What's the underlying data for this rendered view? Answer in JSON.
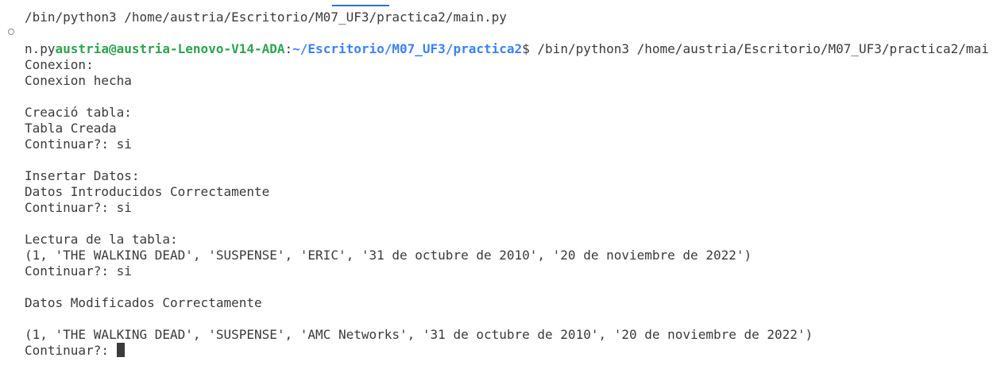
{
  "terminal": {
    "lines": [
      "/bin/python3 /home/austria/Escritorio/M07_UF3/practica2/main.py",
      "",
      "n.py",
      "Conexion:",
      "Conexion hecha",
      "",
      "Creació tabla:",
      "Tabla Creada",
      "Continuar?: si",
      "",
      "Insertar Datos:",
      "Datos Introducidos Correctamente",
      "Continuar?: si",
      "",
      "Lectura de la tabla:",
      "(1, 'THE WALKING DEAD', 'SUSPENSE', 'ERIC', '31 de octubre de 2010', '20 de noviembre de 2022')",
      "Continuar?: si",
      "",
      "Datos Modificados Correctamente",
      "",
      "(1, 'THE WALKING DEAD', 'SUSPENSE', 'AMC Networks', '31 de octubre de 2010', '20 de noviembre de 2022')",
      "Continuar?: "
    ],
    "prompt": {
      "user_host": "austria@austria-Lenovo-V14-ADA",
      "separator": ":",
      "path": "~/Escritorio/M07_UF3/practica2",
      "symbol": "$",
      "command": " /bin/python3 /home/austria/Escritorio/M07_UF3/practica2/mai"
    },
    "colors": {
      "user_host": "#2da44e",
      "path": "#3b82f6",
      "text": "#3b3b3b",
      "tab_indicator": "#2f6fd6"
    }
  }
}
